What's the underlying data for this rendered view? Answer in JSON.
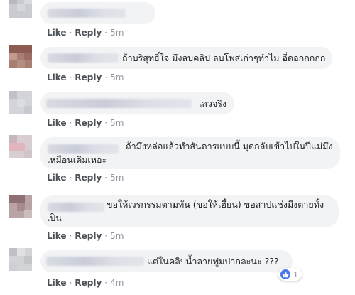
{
  "actions": {
    "like": "Like",
    "reply": "Reply",
    "separator": "·"
  },
  "comments": [
    {
      "text": "",
      "time": "5m"
    },
    {
      "text": "ถ้าบริสุทธิ์ใจ มึงลบคลิป ลบโพสเก่าๆทำไม อี่ดอกกกกก",
      "time": "5m"
    },
    {
      "text": "เลวจริง",
      "time": "5m"
    },
    {
      "text_line1": "ถ้ามึงหล่อแล้วทำสันดารแบบนี้ มุดกลับเข้าไปในปีแม่มึง",
      "text_line2": "เหมือนเดิมเหอะ",
      "time": "5m"
    },
    {
      "text_line1": "ขอให้เวรกรรมตามทัน (ขอให้เฮี้ยน) ขอสาปแช่งมึงตายทั้ง",
      "text_line2": "เป็น",
      "time": "5m"
    },
    {
      "text": "แต่ในคลิปน้ำลายฟูมปากละนะ ???",
      "time": "4m",
      "reaction_count": "1",
      "reaction_icon": "like-icon"
    }
  ],
  "colors": {
    "bubble": "#f2f3f5",
    "action_link": "#4b4f56",
    "reaction": "#4a78e8"
  }
}
